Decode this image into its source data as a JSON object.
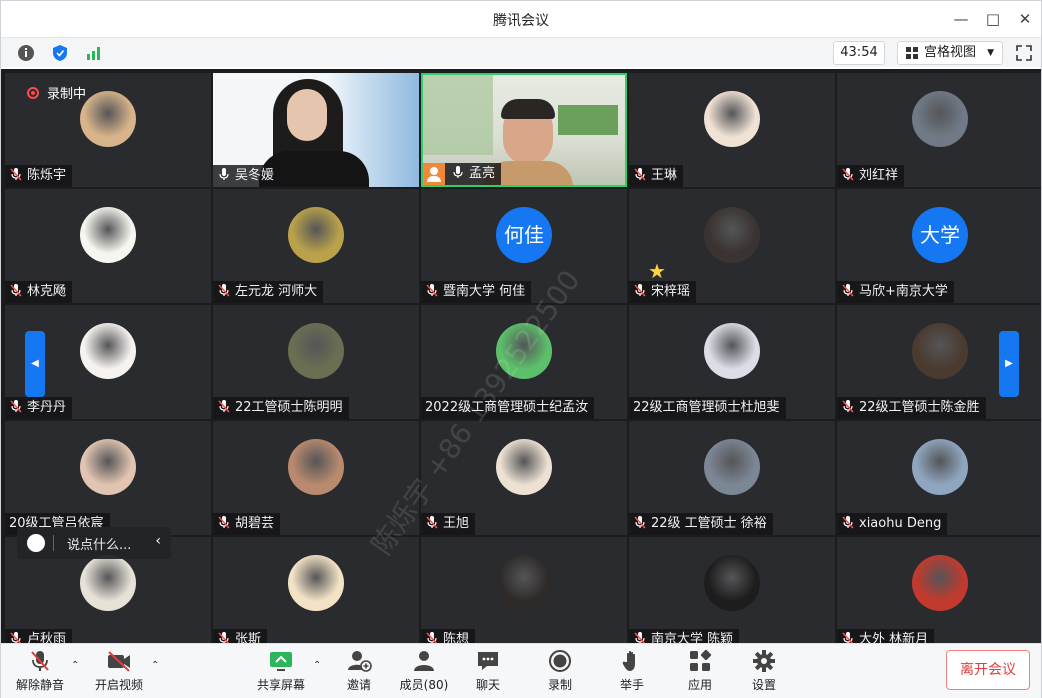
{
  "window": {
    "title": "腾讯会议"
  },
  "topbar": {
    "timer": "43:54",
    "view_label": "宫格视图"
  },
  "recording": {
    "label": "录制中"
  },
  "chat": {
    "placeholder": "说点什么..."
  },
  "watermark": "陈烁宇 +86 1392522500",
  "participants": [
    {
      "name": "陈烁宇",
      "avatar_color": "#d8b48a",
      "muted": true
    },
    {
      "name": "吴冬媛",
      "video": true,
      "avatar_color": "#9fc7e6",
      "muted": false
    },
    {
      "name": "孟亮",
      "video": true,
      "avatar_color": "#c7d2c0",
      "muted": false,
      "host": true
    },
    {
      "name": "王琳",
      "avatar_color": "#f1e2d6",
      "muted": true
    },
    {
      "name": "刘红祥",
      "avatar_color": "#707a86",
      "muted": true
    },
    {
      "name": "林克飏",
      "avatar_color": "#f4f6ef",
      "muted": true
    },
    {
      "name": "左元龙 河师大",
      "avatar_color": "#b9a24a",
      "muted": true
    },
    {
      "name": "暨南大学 何佳",
      "avatar_text": "何佳",
      "muted": true
    },
    {
      "name": "宋梓瑶",
      "avatar_color": "#3a3331",
      "muted": true
    },
    {
      "name": "马欣+南京大学",
      "avatar_text": "大学",
      "muted": true
    },
    {
      "name": "李丹丹",
      "avatar_color": "#f6f2ef",
      "muted": true
    },
    {
      "name": "22工管硕士陈明明",
      "avatar_color": "#6b6f52",
      "muted": true
    },
    {
      "name": "2022级工商管理硕士纪孟汝",
      "avatar_color": "#5cc06a",
      "muted": false,
      "no_mic": true
    },
    {
      "name": "22级工商管理硕士杜旭斐",
      "avatar_color": "#dcdde6",
      "muted": false,
      "no_mic": true
    },
    {
      "name": "22级工管硕士陈金胜",
      "avatar_color": "#4b3a2f",
      "muted": true
    },
    {
      "name": "20级工管吕依宸",
      "avatar_color": "#e1c4b1",
      "muted": false,
      "no_mic": true
    },
    {
      "name": "胡碧芸",
      "avatar_color": "#b98a6e",
      "muted": true
    },
    {
      "name": "王旭",
      "avatar_color": "#ece1d2",
      "muted": true
    },
    {
      "name": "22级 工管硕士 徐裕",
      "avatar_color": "#7c8796",
      "muted": true
    },
    {
      "name": "xiaohu Deng",
      "avatar_color": "#8fa6c0",
      "muted": true
    },
    {
      "name": "卢秋雨",
      "avatar_color": "#e7e2d8",
      "muted": true
    },
    {
      "name": "张斯",
      "avatar_color": "#f3e3c6",
      "muted": true
    },
    {
      "name": "陈想",
      "avatar_color": "#2e2a2a",
      "muted": true
    },
    {
      "name": "南京大学 陈颖",
      "avatar_color": "#1d1d1d",
      "muted": true
    },
    {
      "name": "大外 林新月",
      "avatar_color": "#c23a2d",
      "muted": true
    }
  ],
  "toolbar": {
    "unmute": "解除静音",
    "start_video": "开启视频",
    "share": "共享屏幕",
    "invite": "邀请",
    "members": "成员(80)",
    "chat": "聊天",
    "record": "录制",
    "raise_hand": "举手",
    "apps": "应用",
    "settings": "设置",
    "leave": "离开会议"
  },
  "colors": {
    "accent": "#1677f2",
    "active_border": "#2fcf6a",
    "leave": "#e23c3c"
  }
}
